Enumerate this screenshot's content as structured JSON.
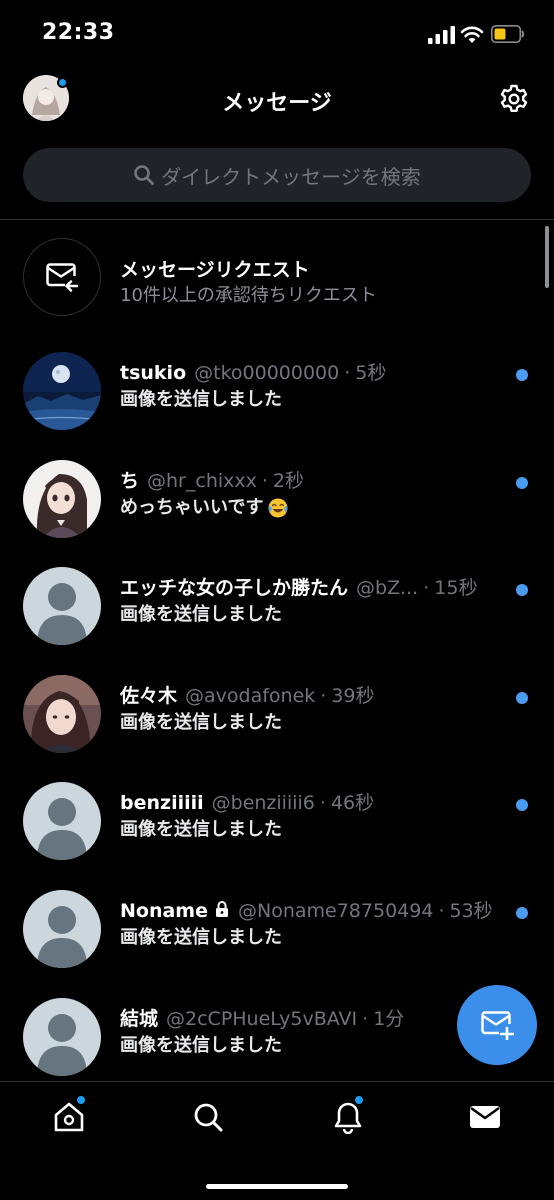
{
  "status_bar": {
    "time": "22:33"
  },
  "header": {
    "title": "メッセージ"
  },
  "search": {
    "placeholder": "ダイレクトメッセージを検索"
  },
  "message_requests": {
    "title": "メッセージリクエスト",
    "subtitle": "10件以上の承認待ちリクエスト"
  },
  "conversations": [
    {
      "name": "tsukio",
      "handle": "@tko00000000",
      "time": "5秒",
      "preview": "画像を送信しました",
      "unread": true,
      "avatar": "moon-photo"
    },
    {
      "name": "ち",
      "handle": "@hr_chixxx",
      "time": "2秒",
      "preview": "めっちゃいいです",
      "emoji": "crying-laughing-face",
      "unread": true,
      "avatar": "anime-illustration"
    },
    {
      "name": "エッチな女の子しか勝たん",
      "handle": "@bZ...",
      "time": "15秒",
      "preview": "画像を送信しました",
      "unread": true,
      "avatar": "default"
    },
    {
      "name": "佐々木",
      "handle": "@avodafonek",
      "time": "39秒",
      "preview": "画像を送信しました",
      "unread": true,
      "avatar": "photo"
    },
    {
      "name": "benziiiii",
      "handle": "@benziiiii6",
      "time": "46秒",
      "preview": "画像を送信しました",
      "unread": true,
      "avatar": "default"
    },
    {
      "name": "Noname",
      "locked": true,
      "handle": "@Noname78750494",
      "time": "53秒",
      "preview": "画像を送信しました",
      "unread": true,
      "avatar": "default"
    },
    {
      "name": "結城",
      "handle": "@2cCPHueLy5vBAVI",
      "time": "1分",
      "preview": "画像を送信しました",
      "unread": false,
      "avatar": "default"
    }
  ],
  "separator": "·",
  "bottom_nav": [
    {
      "icon": "home-icon",
      "has_badge": true
    },
    {
      "icon": "search-icon",
      "has_badge": false
    },
    {
      "icon": "bell-icon",
      "has_badge": true
    },
    {
      "icon": "mail-icon",
      "has_badge": false,
      "active": true
    }
  ],
  "colors": {
    "accent": "#1d9bf0",
    "fab": "#3b8eea",
    "background": "#000000",
    "muted_text": "#71767b"
  }
}
